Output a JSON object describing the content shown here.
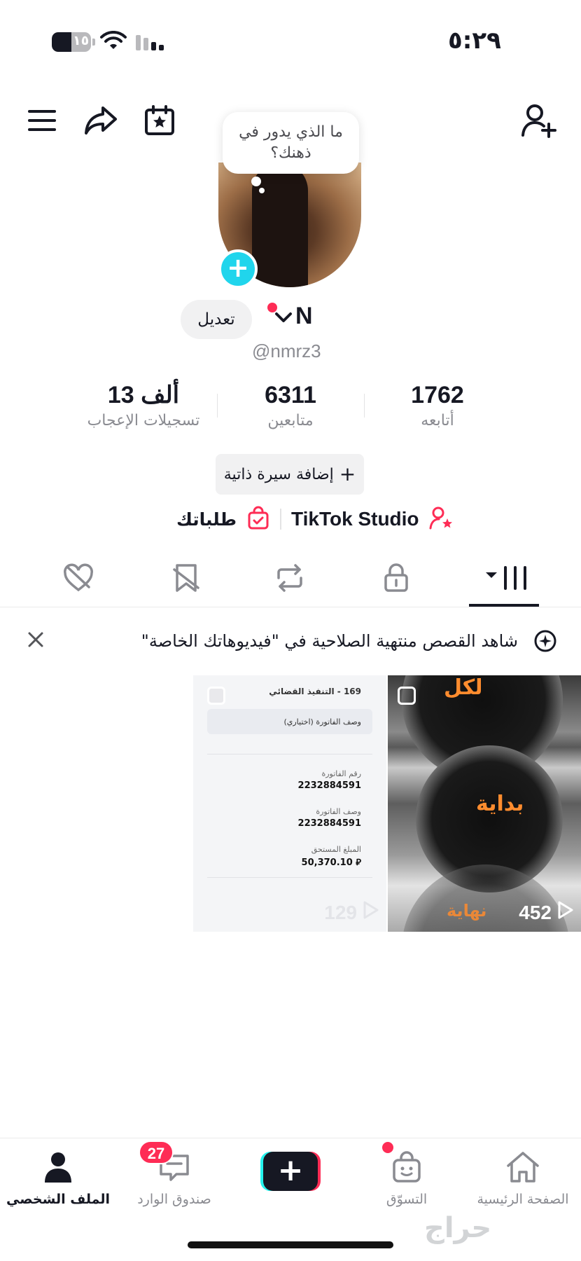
{
  "status_bar": {
    "time": "٥:٢٩",
    "battery_level": "١٥",
    "battery_fraction": 0.5
  },
  "profile": {
    "bubble_text": "ما الذي يدور في ذهنك؟",
    "edit_label": "تعديل",
    "display_name": "N",
    "username": "@nmrz3"
  },
  "stats": [
    {
      "value": "1762",
      "label": "أتابعه"
    },
    {
      "value": "6311",
      "label": "متابعين"
    },
    {
      "value": "13 ألف",
      "label": "تسجيلات الإعجاب"
    }
  ],
  "bio_button": {
    "label": "إضافة سيرة ذاتية",
    "icon": "plus-icon"
  },
  "links": {
    "studio": "TikTok Studio",
    "orders": "طلباتك"
  },
  "tabs": [
    {
      "name": "videos",
      "icon": "grid-icon",
      "active": true
    },
    {
      "name": "private",
      "icon": "lock-icon"
    },
    {
      "name": "reposts",
      "icon": "repost-icon"
    },
    {
      "name": "favorites",
      "icon": "bookmark-icon"
    },
    {
      "name": "liked",
      "icon": "heart-icon"
    }
  ],
  "banner": {
    "text": "شاهد القصص منتهية الصلاحية في \"فيديوهاتك الخاصة\""
  },
  "videos": [
    {
      "words": [
        "لكل",
        "بداية",
        "نهاية"
      ],
      "views": "452"
    },
    {
      "views": "129",
      "doc": {
        "header": "169 - التنفيذ القضائي",
        "field_hint": "وصف الفاتورة (اختياري)",
        "invoice_number_label": "رقم الفاتورة",
        "invoice_number": "2232884591",
        "invoice_desc_label": "وصف الفاتورة",
        "invoice_desc": "2232884591",
        "amount_label": "المبلغ المستحق",
        "amount": "50,370.10 ⃁"
      }
    }
  ],
  "bottom_nav": {
    "home": "الصفحة الرئيسية",
    "shop": "التسوّق",
    "inbox": "صندوق الوارد",
    "profile": "الملف الشخصي",
    "inbox_badge": "27"
  },
  "watermark": "حراج",
  "colors": {
    "accent": "#fe2c55",
    "cyan": "#20d5ec",
    "text": "#161823",
    "muted": "#8a8b91"
  }
}
